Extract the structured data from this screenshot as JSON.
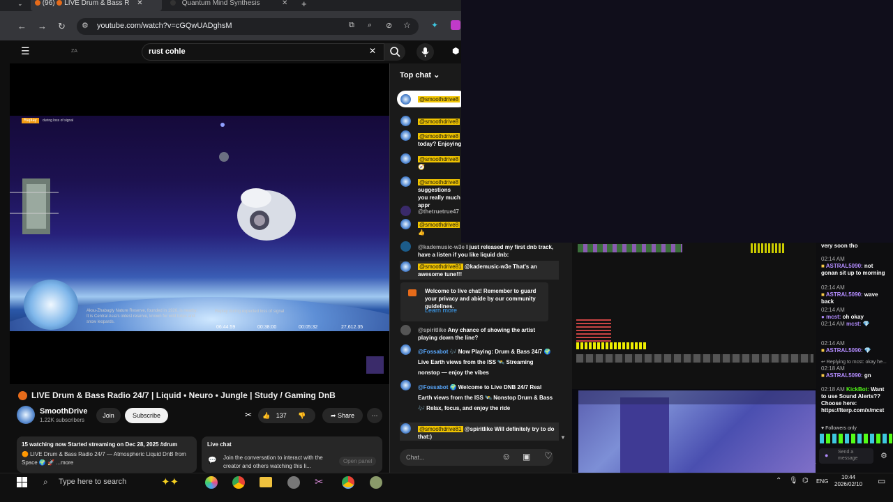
{
  "browser": {
    "tab_count": "(96)",
    "tab1_title": "LIVE Drum & Bass R",
    "tab2_title": "Quantum Mind Synthesis",
    "url": "youtube.com/watch?v=cGQwUADghsM"
  },
  "youtube": {
    "logo_text": "ZA",
    "search_value": "rust cohle",
    "video": {
      "replay_tag": "Replay",
      "replay_text": "during loss of signal",
      "info_text": "Aksu-Zhabagly Nature Reserve, founded in 1926, is nearby. It is Central Asia's oldest reserve, known for wild tulips and snow leopards.",
      "telemetry_label": "Replay during expected loss of signal",
      "tele_1": "06:44:59",
      "tele_2": "00:38:00",
      "tele_3": "00:05:32",
      "tele_4": "27,612.35"
    },
    "title": "LIVE Drum & Bass Radio 24/7 | Liquid • Neuro • Jungle | Study / Gaming DnB",
    "channel": "SmoothDrive",
    "subscribers": "1.22K subscribers",
    "join": "Join",
    "subscribe": "Subscribe",
    "likes": "137",
    "share": "Share",
    "description_line1": "15 watching now  Started streaming on Dec 28, 2025  #drum",
    "description_line2": "🟠 LIVE Drum & Bass Radio 24/7 — Atmospheric Liquid DnB from Space 🌍 🚀  ...more",
    "live_chat_title": "Live chat",
    "live_chat_text": "Join the conversation to interact with the creator and others watching this li...",
    "open_panel": "Open panel"
  },
  "chat": {
    "header": "Top chat",
    "pinned_user": "@smoothdrive8",
    "messages": [
      {
        "user": "@smoothdrive8",
        "text": ""
      },
      {
        "user": "@smoothdrive8",
        "text": "today? Enjoying t"
      },
      {
        "user": "@smoothdrive8",
        "text": "🧭"
      },
      {
        "user": "@smoothdrive8",
        "text": "suggestions you really much appr"
      },
      {
        "user": "@thetruetrue47",
        "text": ""
      },
      {
        "user": "@smoothdrive8",
        "text": "👍"
      },
      {
        "user": "@kademusic-w3e",
        "text": "I just released my first dnb track, have a listen if you like liquid dnb:"
      },
      {
        "user": "@smoothdrive81",
        "text": "@kademusic-w3e That's an awesome tune!!!"
      },
      {
        "user": "@spiritlike",
        "text": "Any chance of showing the artist playing down the line?"
      },
      {
        "user": "@Fossabot",
        "text": "🎶 Now Playing: Drum & Bass 24/7 🌍 Live Earth views from the ISS 🛰️ Streaming nonstop — enjoy the vibes"
      },
      {
        "user": "@Fossabot",
        "text": "🌍 Welcome to Live DNB 24/7 Real Earth views from the ISS 🛰️ Nonstop Drum & Bass 🎶 Relax, focus, and enjoy the ride"
      },
      {
        "user": "@smoothdrive81",
        "text": "@spiritlike Will definitely try to do that:)"
      }
    ],
    "welcome": "Welcome to live chat! Remember to guard your privacy and abide by our community guidelines.",
    "learn_more": "Learn more",
    "input_placeholder": "Chat..."
  },
  "kick": {
    "lines": [
      {
        "time": "",
        "user": "",
        "text": "very soon tho"
      },
      {
        "time": "02:14 AM",
        "user": "ASTRAL5090:",
        "text": "not gonan sit up to morning"
      },
      {
        "time": "02:14 AM",
        "user": "ASTRAL5090:",
        "text": "wave back"
      },
      {
        "time": "02:14 AM",
        "user": "mcst:",
        "text": "oh okay"
      },
      {
        "time": "02:14 AM",
        "user": "mcst:",
        "text": "💎"
      },
      {
        "time": "02:14 AM",
        "user": "ASTRAL5090:",
        "text": "💎"
      },
      {
        "time": "",
        "user": "",
        "text": "↩ Replying to mcst: okay he..."
      },
      {
        "time": "02:18 AM",
        "user": "ASTRAL5090:",
        "text": "gn"
      },
      {
        "time": "02:18 AM",
        "user": "KickBot:",
        "text": "Want to use Sound Alerts?? Choose here: https://lterp.com/x/mcst"
      }
    ],
    "followers_only": "Followers only",
    "send_message": "Send a message"
  },
  "taskbar": {
    "search_placeholder": "Type here to search",
    "lang": "ENG",
    "time": "10:44",
    "date": "2026/02/10"
  },
  "colors": {
    "accent_youtube": "#ff0000",
    "highlight_name": "#f0c400",
    "kick_green": "#53fc18"
  }
}
